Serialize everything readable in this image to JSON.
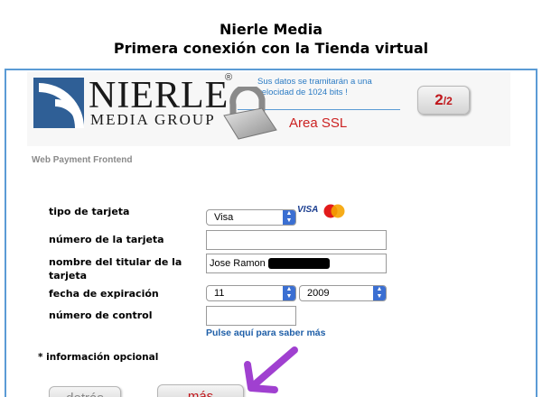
{
  "page": {
    "title_line1": "Nierle Media",
    "title_line2": "Primera conexión con la Tienda virtual"
  },
  "header": {
    "logo_line1": "NIERLE",
    "logo_line2": "MEDIA GROUP",
    "registered_mark": "®",
    "ssl_notice": "Sus datos se tramitarán a una velocidad de 1024 bits !",
    "area_label": "Area SSL",
    "step_current": "2",
    "step_total": "2"
  },
  "section_label": "Web Payment Frontend",
  "form": {
    "card_type": {
      "label": "tipo de tarjeta",
      "value": "Visa",
      "brands": [
        "VISA",
        "MasterCard"
      ]
    },
    "card_number": {
      "label": "número de la tarjeta",
      "value": ""
    },
    "holder_name": {
      "label": "nombre del titular de la tarjeta",
      "value": "Jose Ramon"
    },
    "expiry": {
      "label": "fecha de expiración",
      "month": "11",
      "year": "2009"
    },
    "control_number": {
      "label": "número de control",
      "value": ""
    },
    "help_link": "Pulse aquí para saber más"
  },
  "optional_note": "* información opcional",
  "buttons": {
    "back": "detrás",
    "next": "más"
  },
  "colors": {
    "accent_blue": "#5b9bd5",
    "link_blue": "#1f5fa8",
    "brand_red": "#c0161b",
    "annotation_purple": "#a040d0"
  }
}
